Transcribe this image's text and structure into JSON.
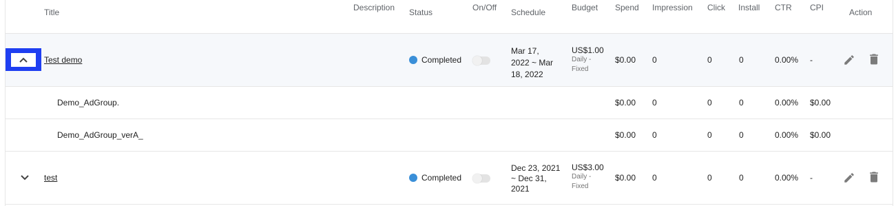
{
  "header": {
    "title": "Title",
    "description": "Description",
    "status": "Status",
    "onoff": "On/Off",
    "schedule": "Schedule",
    "budget": "Budget",
    "spend": "Spend",
    "impression": "Impression",
    "click": "Click",
    "install": "Install",
    "ctr": "CTR",
    "cpi": "CPI",
    "action": "Action"
  },
  "rows": [
    {
      "type": "campaign",
      "expanded": true,
      "title": "Test demo",
      "status": "Completed",
      "status_color": "#3a8fd8",
      "schedule_line1": "Mar 17,",
      "schedule_line2": "2022 ~ Mar",
      "schedule_line3": "18, 2022",
      "budget": "US$1.00",
      "budget_sub1": "Daily -",
      "budget_sub2": "Fixed",
      "spend": "$0.00",
      "impression": "0",
      "click": "0",
      "install": "0",
      "ctr": "0.00%",
      "cpi": "-",
      "toggle_on": false
    },
    {
      "type": "adgroup",
      "title": "Demo_AdGroup.",
      "spend": "$0.00",
      "impression": "0",
      "click": "0",
      "install": "0",
      "ctr": "0.00%",
      "cpi": "$0.00"
    },
    {
      "type": "adgroup",
      "title": "Demo_AdGroup_verA_",
      "spend": "$0.00",
      "impression": "0",
      "click": "0",
      "install": "0",
      "ctr": "0.00%",
      "cpi": "$0.00"
    },
    {
      "type": "campaign",
      "expanded": false,
      "title": "test",
      "status": "Completed",
      "status_color": "#3a8fd8",
      "schedule_line1": "Dec 23, 2021",
      "schedule_line2": "~ Dec 31,",
      "schedule_line3": "2021",
      "budget": "US$3.00",
      "budget_sub1": "Daily -",
      "budget_sub2": "Fixed",
      "spend": "$0.00",
      "impression": "0",
      "click": "0",
      "install": "0",
      "ctr": "0.00%",
      "cpi": "-",
      "toggle_on": false
    }
  ],
  "icons": {
    "expand": "chevron-up-icon",
    "collapse": "chevron-down-icon",
    "edit": "pencil-icon",
    "delete": "trash-icon"
  },
  "colors": {
    "focus_outline": "#1f3ff1",
    "expanded_row_bg": "#f6f8fb",
    "status_completed": "#3a8fd8",
    "icon_gray": "#7b7b7b"
  }
}
